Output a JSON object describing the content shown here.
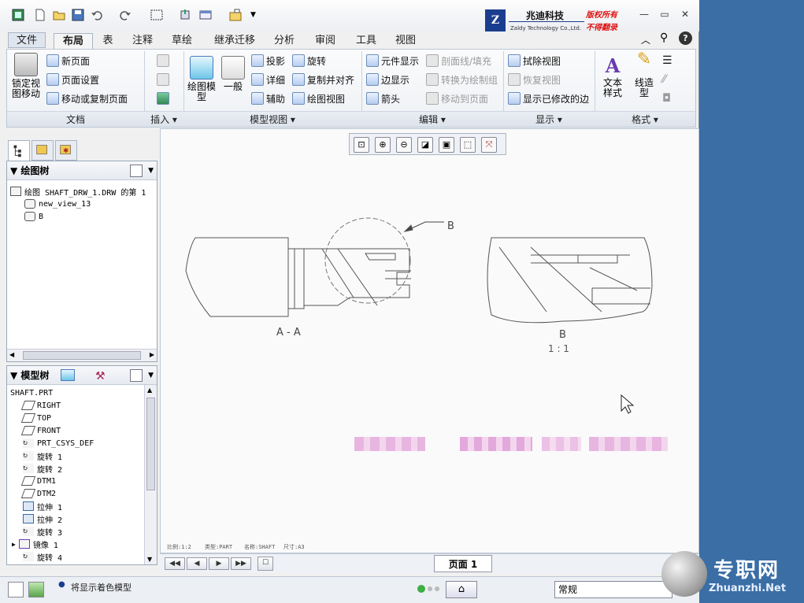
{
  "logo": {
    "mark": "Z",
    "company_cn": "兆迪科技",
    "company_en": "Zaldy Technology Co.,Ltd.",
    "rights_line1": "版权所有",
    "rights_line2": "不得翻录"
  },
  "tabs": [
    "文件",
    "布局",
    "表",
    "注释",
    "草绘",
    "继承迁移",
    "分析",
    "审阅",
    "工具",
    "视图"
  ],
  "ribbon": {
    "lock_view": "锁定视图移动",
    "doc": [
      "新页面",
      "页面设置",
      "移动或复制页面"
    ],
    "draw_model": "绘图模型",
    "general": "一般",
    "model_view": [
      "投影",
      "详细",
      "辅助",
      "旋转",
      "复制并对齐",
      "绘图视图"
    ],
    "edit": [
      "元件显示",
      "边显示",
      "箭头",
      "剖面线/填充",
      "转换为绘制组",
      "移动到页面"
    ],
    "display": [
      "拭除视图",
      "恢复视图",
      "显示已修改的边"
    ],
    "text_style": "文本样式",
    "line_style": "线造型",
    "groups": [
      "文档",
      "插入",
      "模型视图",
      "编辑",
      "显示",
      "格式"
    ]
  },
  "drawing_tree": {
    "title": "绘图树",
    "items": [
      "绘图 SHAFT_DRW_1.DRW 的第 1",
      "new_view_13",
      "B"
    ]
  },
  "model_tree": {
    "title": "模型树",
    "root": "SHAFT.PRT",
    "items": [
      "RIGHT",
      "TOP",
      "FRONT",
      "PRT_CSYS_DEF",
      "旋转 1",
      "旋转 2",
      "DTM1",
      "DTM2",
      "拉伸 1",
      "拉伸 2",
      "旋转 3",
      "镜像 1",
      "旋转 4"
    ]
  },
  "drawing": {
    "section_label": "A - A",
    "detail_callout": "B",
    "detail_label": "B",
    "detail_scale": "1 : 1",
    "footer": [
      "比例:1:2",
      "类型:PART",
      "名称:SHAFT",
      "尺寸:A3"
    ]
  },
  "pager": {
    "page_tab": "页面 1"
  },
  "status": {
    "message": "将显示着色模型",
    "filter": "常规"
  },
  "watermark": {
    "title": "专职网",
    "url": "Zhuanzhi.Net"
  },
  "colors": {
    "accent": "#1b3d8f",
    "desktop": "#3a6ea5",
    "blur_pixels": "#e7b6e0"
  }
}
